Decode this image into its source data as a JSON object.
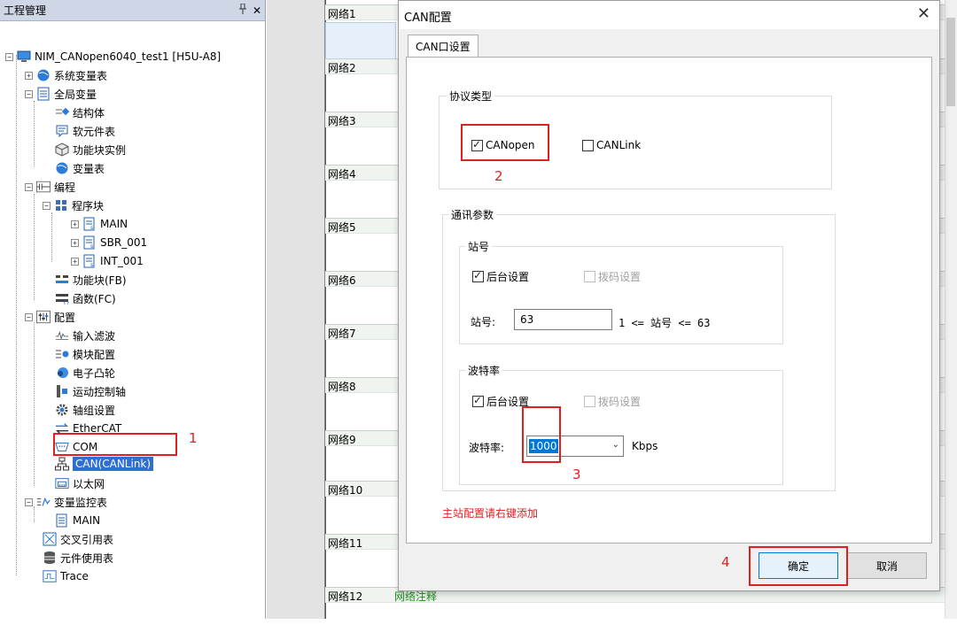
{
  "project_panel": {
    "title": "工程管理",
    "pin_icon": "pin-icon",
    "close_label": "✕",
    "tree": [
      {
        "label": "NIM_CANopen6040_test1 [H5U-A8]",
        "icon": "computer-icon"
      },
      {
        "label": "系统变量表",
        "icon": "globe-icon"
      },
      {
        "label": "全局变量",
        "icon": "table-icon"
      },
      {
        "label": "结构体",
        "icon": "struct-icon"
      },
      {
        "label": "软元件表",
        "icon": "memo-icon"
      },
      {
        "label": "功能块实例",
        "icon": "cube-icon"
      },
      {
        "label": "变量表",
        "icon": "globe-icon"
      },
      {
        "label": "编程",
        "icon": "ladder-icon"
      },
      {
        "label": "程序块",
        "icon": "blocks-icon"
      },
      {
        "label": "MAIN",
        "icon": "program-icon"
      },
      {
        "label": "SBR_001",
        "icon": "program-icon"
      },
      {
        "label": "INT_001",
        "icon": "program-icon"
      },
      {
        "label": "功能块(FB)",
        "icon": "fb-icon"
      },
      {
        "label": "函数(FC)",
        "icon": "fc-icon"
      },
      {
        "label": "配置",
        "icon": "config-icon"
      },
      {
        "label": "输入滤波",
        "icon": "filter-icon"
      },
      {
        "label": "模块配置",
        "icon": "module-icon"
      },
      {
        "label": "电子凸轮",
        "icon": "cam-icon"
      },
      {
        "label": "运动控制轴",
        "icon": "axis-icon"
      },
      {
        "label": "轴组设置",
        "icon": "gear-icon"
      },
      {
        "label": "EtherCAT",
        "icon": "ethercat-icon"
      },
      {
        "label": "COM",
        "icon": "serial-port-icon"
      },
      {
        "label": "CAN(CANLink)",
        "icon": "network-icon"
      },
      {
        "label": "以太网",
        "icon": "ethernet-icon"
      },
      {
        "label": "变量监控表",
        "icon": "monitor-icon"
      },
      {
        "label": "MAIN",
        "icon": "program-icon"
      },
      {
        "label": "交叉引用表",
        "icon": "crossref-icon"
      },
      {
        "label": "元件使用表",
        "icon": "database-icon"
      },
      {
        "label": "Trace",
        "icon": "trace-icon"
      }
    ]
  },
  "editor": {
    "networks": [
      "网络1",
      "网络2",
      "网络3",
      "网络4",
      "网络5",
      "网络6",
      "网络7",
      "网络8",
      "网络9",
      "网络10",
      "网络11",
      "网络12"
    ],
    "comment": "网络注释"
  },
  "dialog": {
    "title": "CAN配置",
    "close_label": "✕",
    "tab_label": "CAN口设置",
    "protocol_group": "协议类型",
    "protocol_canopen": "CANopen",
    "protocol_canlink": "CANLink",
    "comm_group": "通讯参数",
    "station_group": "站号",
    "station_bg": "后台设置",
    "station_dip": "拨码设置",
    "station_label": "站号:",
    "station_value": "63",
    "station_range": "1 <= 站号 <= 63",
    "baud_group": "波特率",
    "baud_bg": "后台设置",
    "baud_dip": "拨码设置",
    "baud_label": "波特率:",
    "baud_value": "1000",
    "baud_unit": "Kbps",
    "master_hint": "主站配置请右键添加",
    "ok_label": "确定",
    "cancel_label": "取消"
  },
  "annotations": {
    "n1": "1",
    "n2": "2",
    "n3": "3",
    "n4": "4"
  },
  "colors": {
    "annotation_red": "#e02020",
    "selection_blue": "#2f6fd1",
    "hint_red": "#e02020",
    "comment_green": "#209020"
  }
}
